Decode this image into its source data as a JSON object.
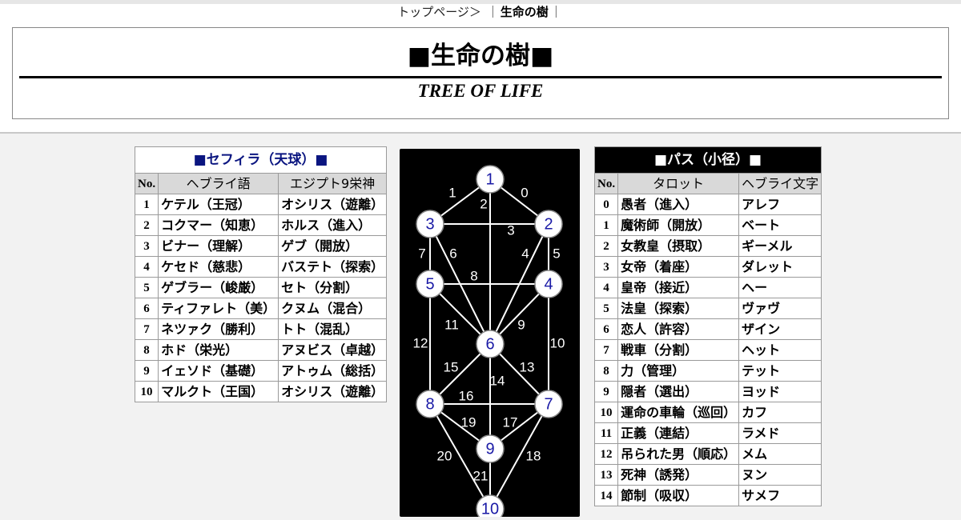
{
  "breadcrumb": {
    "home": "トップページ＞",
    "separator_left": "｜",
    "current": "生命の樹",
    "separator_right": "｜"
  },
  "header": {
    "title": "■生命の樹■",
    "subtitle": "TREE OF LIFE"
  },
  "sephira_table": {
    "caption": "■セフィラ（天球）■",
    "headers": [
      "No.",
      "ヘブライ語",
      "エジプト9栄神"
    ],
    "rows": [
      {
        "no": "1",
        "hebrew": "ケテル（王冠）",
        "egypt": "オシリス（遊離）"
      },
      {
        "no": "2",
        "hebrew": "コクマー（知恵）",
        "egypt": "ホルス（進入）"
      },
      {
        "no": "3",
        "hebrew": "ビナー（理解）",
        "egypt": "ゲブ（開放）"
      },
      {
        "no": "4",
        "hebrew": "ケセド（慈悲）",
        "egypt": "バステト（探索）"
      },
      {
        "no": "5",
        "hebrew": "ゲブラー（峻厳）",
        "egypt": "セト（分割）"
      },
      {
        "no": "6",
        "hebrew": "ティファレト（美）",
        "egypt": "クヌム（混合）"
      },
      {
        "no": "7",
        "hebrew": "ネツァク（勝利）",
        "egypt": "トト（混乱）"
      },
      {
        "no": "8",
        "hebrew": "ホド（栄光）",
        "egypt": "アヌビス（卓越）"
      },
      {
        "no": "9",
        "hebrew": "イェソド（基礎）",
        "egypt": "アトゥム（総括）"
      },
      {
        "no": "10",
        "hebrew": "マルクト（王国）",
        "egypt": "オシリス（遊離）"
      }
    ]
  },
  "path_table": {
    "caption": "■パス（小径）■",
    "headers": [
      "No.",
      "タロット",
      "ヘブライ文字"
    ],
    "rows": [
      {
        "no": "0",
        "tarot": "愚者（進入）",
        "letter": "アレフ"
      },
      {
        "no": "1",
        "tarot": "魔術師（開放）",
        "letter": "ベート"
      },
      {
        "no": "2",
        "tarot": "女教皇（摂取）",
        "letter": "ギーメル"
      },
      {
        "no": "3",
        "tarot": "女帝（着座）",
        "letter": "ダレット"
      },
      {
        "no": "4",
        "tarot": "皇帝（接近）",
        "letter": "ヘー"
      },
      {
        "no": "5",
        "tarot": "法皇（探索）",
        "letter": "ヴァヴ"
      },
      {
        "no": "6",
        "tarot": "恋人（許容）",
        "letter": "ザイン"
      },
      {
        "no": "7",
        "tarot": "戦車（分割）",
        "letter": "ヘット"
      },
      {
        "no": "8",
        "tarot": "力（管理）",
        "letter": "テット"
      },
      {
        "no": "9",
        "tarot": "隠者（選出）",
        "letter": "ヨッド"
      },
      {
        "no": "10",
        "tarot": "運命の車輪（巡回）",
        "letter": "カフ"
      },
      {
        "no": "11",
        "tarot": "正義（連結）",
        "letter": "ラメド"
      },
      {
        "no": "12",
        "tarot": "吊られた男（順応）",
        "letter": "メム"
      },
      {
        "no": "13",
        "tarot": "死神（誘発）",
        "letter": "ヌン"
      },
      {
        "no": "14",
        "tarot": "節制（吸収）",
        "letter": "サメフ"
      }
    ]
  },
  "tree_diagram": {
    "colors": {
      "background": "#000000",
      "line": "#ffffff",
      "node_fill": "#ffffff",
      "node_text": "#1a1aa6",
      "path_label": "#ffffff"
    },
    "nodes": [
      "1",
      "2",
      "3",
      "4",
      "5",
      "6",
      "7",
      "8",
      "9",
      "10"
    ],
    "path_labels": [
      "0",
      "1",
      "2",
      "3",
      "4",
      "5",
      "6",
      "7",
      "8",
      "9",
      "10",
      "11",
      "12",
      "13",
      "14",
      "15",
      "16",
      "17",
      "18",
      "19",
      "20",
      "21"
    ]
  }
}
